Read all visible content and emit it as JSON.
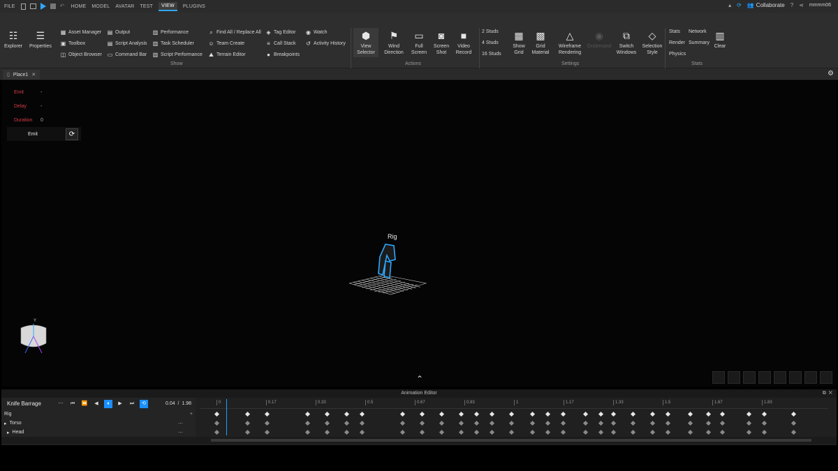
{
  "menubar": {
    "items": [
      "FILE",
      "HOME",
      "MODEL",
      "AVATAR",
      "TEST",
      "VIEW",
      "PLUGINS"
    ],
    "active": "VIEW",
    "collaborate": "Collaborate",
    "user": "mmmm06"
  },
  "ribbon": {
    "explorer": "Explorer",
    "properties": "Properties",
    "show_items": [
      "Asset Manager",
      "Toolbox",
      "Object Browser",
      "Output",
      "Script Analysis",
      "Command Bar",
      "Performance",
      "Task Scheduler",
      "Script Performance",
      "Find All / Replace All",
      "Team Create",
      "Terrain Editor",
      "Tag Editor",
      "Call Stack",
      "Breakpoints",
      "Watch",
      "Activity History"
    ],
    "show_label": "Show",
    "actions": [
      "View Selector",
      "Wind Direction",
      "Full Screen",
      "Screen Shot",
      "Video Record"
    ],
    "actions_label": "Actions",
    "studs": [
      "2 Studs",
      "4 Studs",
      "16 Studs"
    ],
    "settings": [
      "Show Grid",
      "Grid Material",
      "Wireframe Rendering",
      "Ondemand",
      "Switch Windows",
      "Selection Style"
    ],
    "settings_label": "Settings",
    "stats_items": [
      "Stats",
      "Render",
      "Physics",
      "Network",
      "Summary"
    ],
    "clear": "Clear",
    "stats_label": "Stats"
  },
  "tabs": {
    "place": "Place1"
  },
  "viewport": {
    "emit_panel": {
      "emit_label": "Emit",
      "emit_value": "-",
      "delay_label": "Delay",
      "delay_value": "-",
      "duration_label": "Duration",
      "duration_value": "0",
      "button_label": "Emit"
    },
    "rig_label": "Rig",
    "axis_label": "Y"
  },
  "animation_editor": {
    "title": "Animation Editor",
    "animation_name": "Knife Barrage",
    "current_time": "0.04",
    "separator": "/",
    "total_time": "1.98",
    "tracks": [
      "Rig",
      "Torso",
      "Head"
    ],
    "ticks": [
      "0",
      "0.17",
      "0.33",
      "0.5",
      "0.67",
      "0.83",
      "1",
      "1.17",
      "1.33",
      "1.5",
      "1.67",
      "1.83"
    ]
  }
}
